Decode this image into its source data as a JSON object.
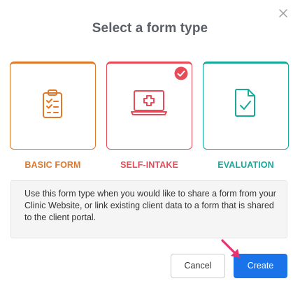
{
  "dialog": {
    "title": "Select a form type",
    "close_icon": "close-icon"
  },
  "form_types": [
    {
      "label": "BASIC FORM",
      "icon": "clipboard-checklist-icon",
      "color": "#e0782a",
      "selected": false
    },
    {
      "label": "SELF-INTAKE",
      "icon": "laptop-medical-cross-icon",
      "color": "#e84a57",
      "selected": true
    },
    {
      "label": "EVALUATION",
      "icon": "document-check-icon",
      "color": "#19a89a",
      "selected": false
    }
  ],
  "selected_check_icon": "check-circle-icon",
  "description": "Use this form type when you would like to share a form from your Clinic Website, or link existing client data to a form that is shared to the client portal.",
  "buttons": {
    "cancel": "Cancel",
    "create": "Create"
  },
  "colors": {
    "accent": "#1a73e8",
    "pointer_arrow": "#e8336f"
  }
}
